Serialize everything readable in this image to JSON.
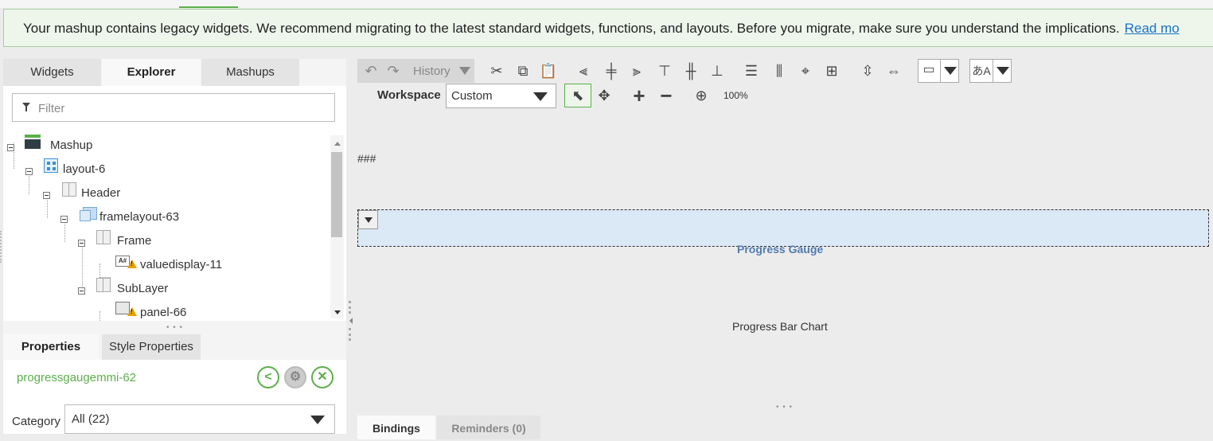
{
  "banner": {
    "message": "Your mashup contains legacy widgets. We recommend migrating to the latest standard widgets, functions, and layouts. Before you migrate, make sure you understand the implications.",
    "link": "Read mo"
  },
  "left_tabs": [
    "Widgets",
    "Explorer",
    "Mashups"
  ],
  "filter": {
    "placeholder": "Filter"
  },
  "tree": [
    {
      "label": "Mashup",
      "icon": "mashup-icon"
    },
    {
      "label": "layout-6",
      "icon": "layout-icon"
    },
    {
      "label": "Header",
      "icon": "panel-icon"
    },
    {
      "label": "framelayout-63",
      "icon": "frame-layout-icon"
    },
    {
      "label": "Frame",
      "icon": "panel-icon"
    },
    {
      "label": "valuedisplay-11",
      "icon": "value-display-icon",
      "warning": true
    },
    {
      "label": "SubLayer",
      "icon": "panel-icon"
    },
    {
      "label": "panel-66",
      "icon": "panel-widget-icon",
      "warning": true
    }
  ],
  "props_tabs": [
    "Properties",
    "Style Properties"
  ],
  "selected_widget": "progressgaugemmi-62",
  "category": {
    "label": "Category",
    "value": "All (22)"
  },
  "toolbar": {
    "history_label": "History",
    "workspace_label": "Workspace",
    "workspace_value": "Custom",
    "zoom": "100%"
  },
  "canvas": {
    "placeholder_text": "###",
    "gauge_label": "Progress Gauge",
    "bar_chart_label": "Progress Bar Chart"
  },
  "bottom_tabs": [
    "Bindings",
    "Reminders (0)"
  ],
  "colors": {
    "accent_green": "#5bb04a",
    "link_blue": "#1a73c8",
    "selection_blue": "#dbe8f5"
  }
}
